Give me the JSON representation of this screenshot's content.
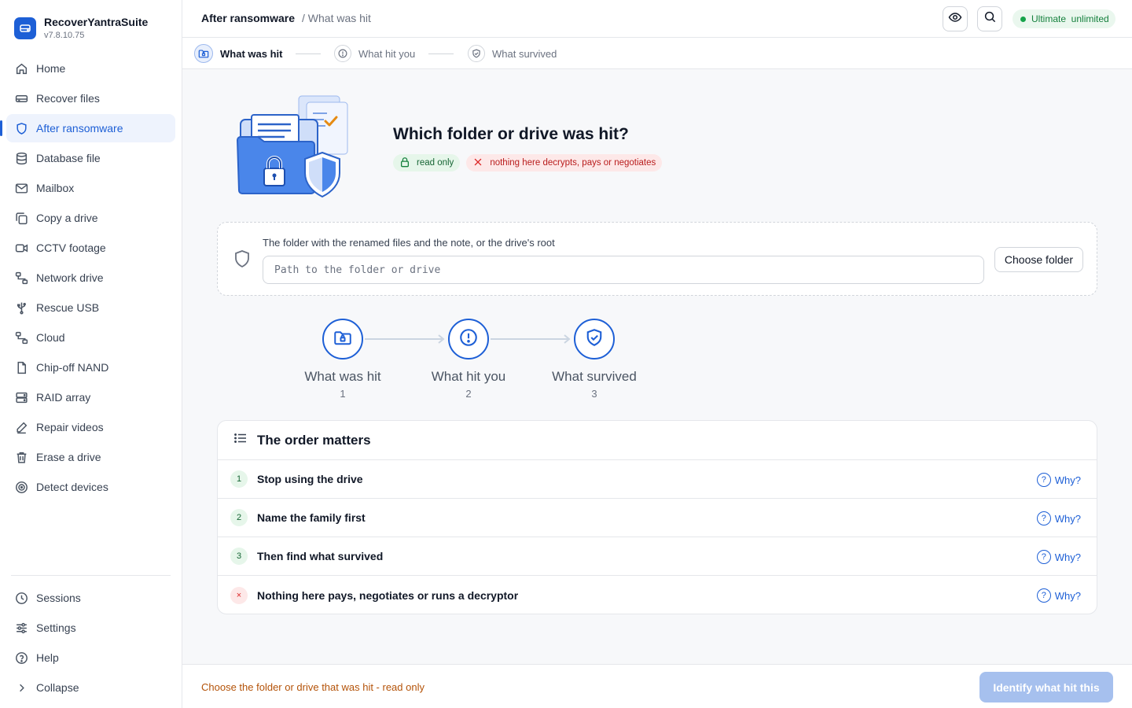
{
  "app": {
    "name": "RecoverYantraSuite",
    "version": "v7.8.10.75"
  },
  "sidebar": {
    "items": [
      {
        "label": "Home",
        "icon": "home-icon"
      },
      {
        "label": "Recover files",
        "icon": "drive-icon"
      },
      {
        "label": "After ransomware",
        "icon": "shield-icon",
        "active": true
      },
      {
        "label": "Database file",
        "icon": "database-icon"
      },
      {
        "label": "Mailbox",
        "icon": "mail-icon"
      },
      {
        "label": "Copy a drive",
        "icon": "copy-icon"
      },
      {
        "label": "CCTV footage",
        "icon": "video-icon"
      },
      {
        "label": "Network drive",
        "icon": "network-icon"
      },
      {
        "label": "Rescue USB",
        "icon": "usb-icon"
      },
      {
        "label": "Cloud",
        "icon": "cloud-icon"
      },
      {
        "label": "Chip-off NAND",
        "icon": "chip-icon"
      },
      {
        "label": "RAID array",
        "icon": "raid-icon"
      },
      {
        "label": "Repair videos",
        "icon": "repair-icon"
      },
      {
        "label": "Erase a drive",
        "icon": "trash-icon"
      },
      {
        "label": "Detect devices",
        "icon": "detect-icon"
      }
    ],
    "bottom": [
      {
        "label": "Sessions",
        "icon": "clock-icon"
      },
      {
        "label": "Settings",
        "icon": "sliders-icon"
      },
      {
        "label": "Help",
        "icon": "help-icon"
      },
      {
        "label": "Collapse",
        "icon": "chevron-right-icon"
      }
    ]
  },
  "header": {
    "title": "After ransomware",
    "subtitle": "/ What was hit",
    "plan": "Ultimate  unlimited",
    "plan_color": "#16a34a"
  },
  "stepper": [
    {
      "label": "What was hit",
      "active": true
    },
    {
      "label": "What hit you",
      "active": false
    },
    {
      "label": "What survived",
      "active": false
    }
  ],
  "hero": {
    "title": "Which folder or drive was hit?",
    "chip_readonly": "read only",
    "chip_warning": "nothing here decrypts, pays or negotiates"
  },
  "picker": {
    "label": "The folder with the renamed files and the note, or the drive's root",
    "placeholder": "Path to the folder or drive",
    "value": "",
    "button": "Choose folder"
  },
  "flow": [
    {
      "label": "What was hit",
      "num": "1"
    },
    {
      "label": "What hit you",
      "num": "2"
    },
    {
      "label": "What survived",
      "num": "3"
    }
  ],
  "order": {
    "title": "The order matters",
    "why_label": "Why?",
    "rows": [
      {
        "num": "1",
        "text": "Stop using the drive"
      },
      {
        "num": "2",
        "text": "Name the family first"
      },
      {
        "num": "3",
        "text": "Then find what survived"
      },
      {
        "num": "×",
        "text": "Nothing here pays, negotiates or runs a decryptor"
      }
    ]
  },
  "footer": {
    "status": "Choose the folder or drive that was hit - read only",
    "primary_button": "Identify what hit this"
  },
  "colors": {
    "accent": "#1d5fd6",
    "warning_text": "#b45309",
    "disabled_button": "#a6c0ee"
  }
}
